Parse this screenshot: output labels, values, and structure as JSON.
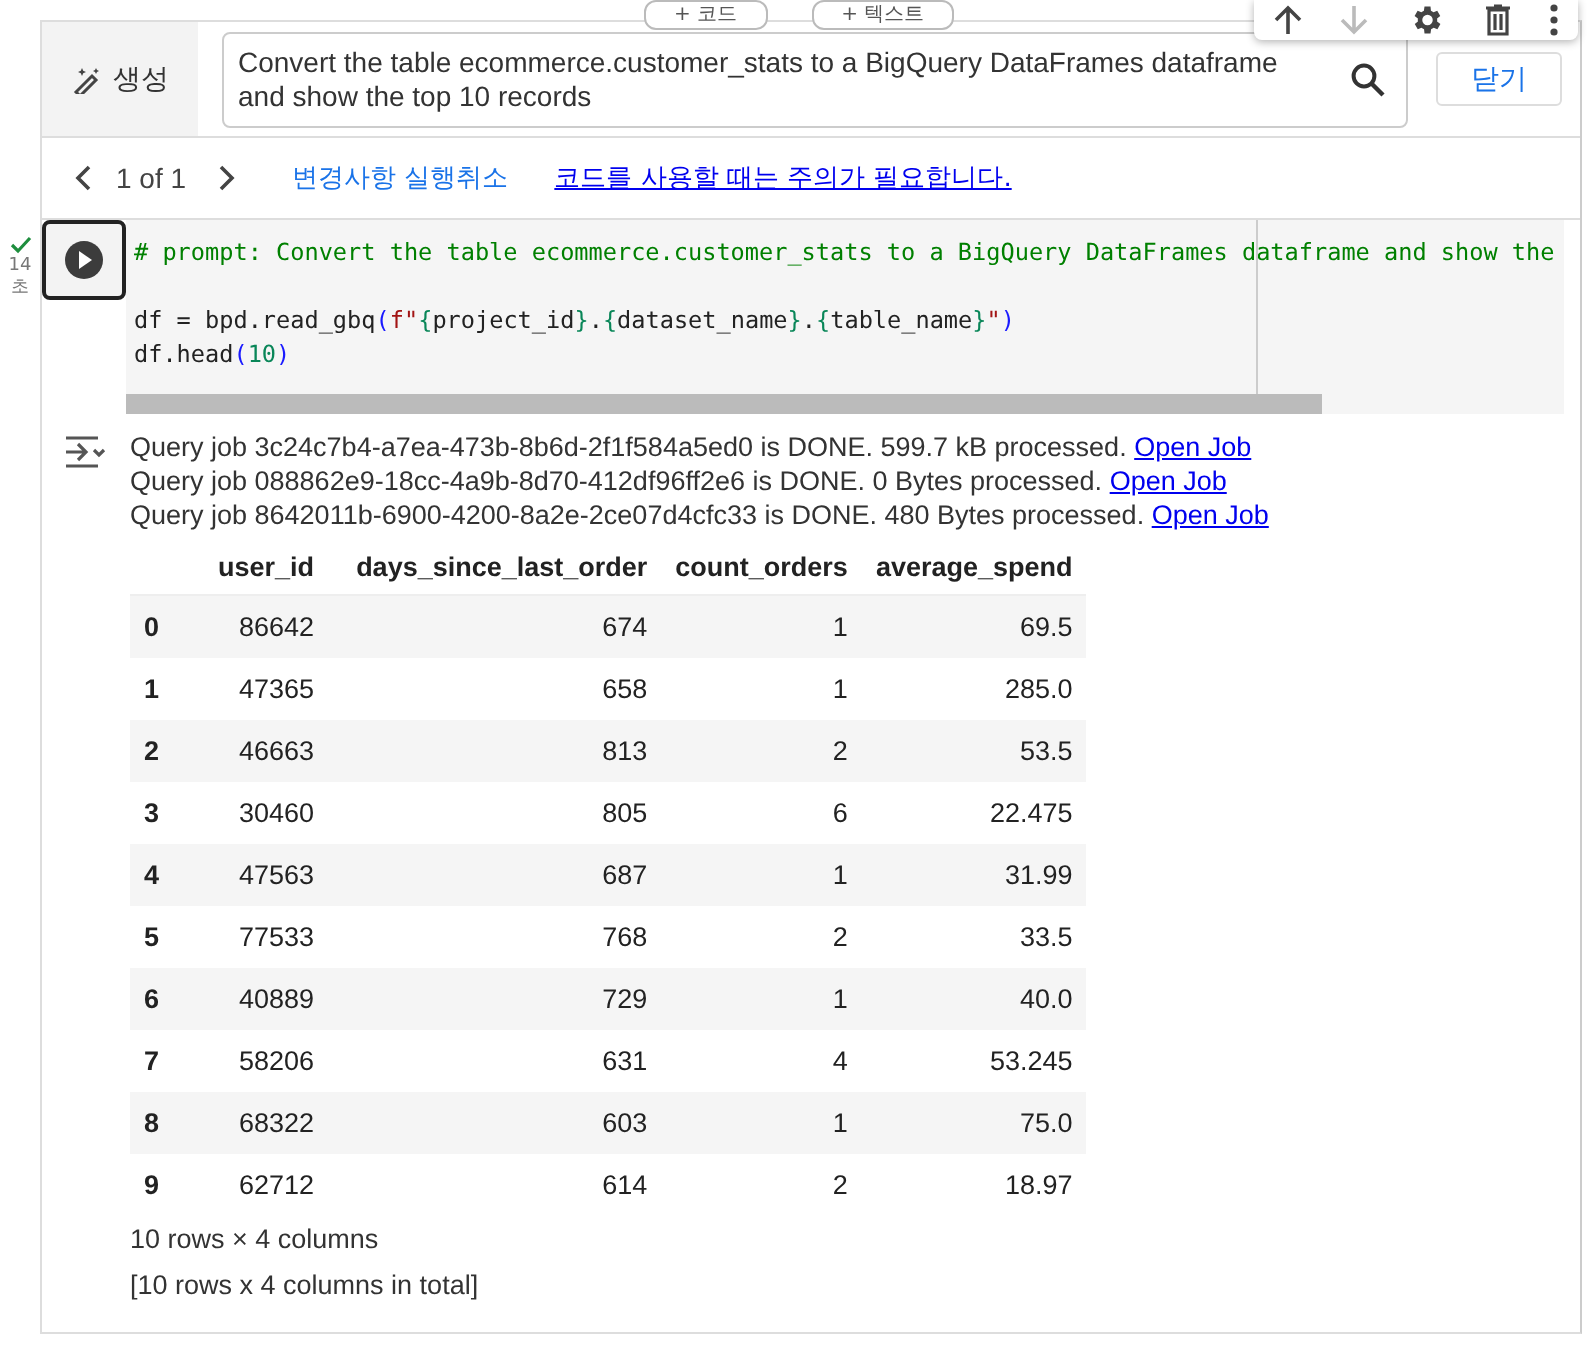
{
  "insert_buttons": [
    "+ 코드",
    "+ 텍스트"
  ],
  "cell_toolbar": [
    {
      "kind": "up",
      "disabled": false
    },
    {
      "kind": "down",
      "disabled": true
    },
    {
      "kind": "settings",
      "disabled": false
    },
    {
      "kind": "delete",
      "disabled": false
    },
    {
      "kind": "more",
      "disabled": false
    }
  ],
  "run_status": {
    "done": true,
    "time": "14",
    "unit": "초"
  },
  "generate": {
    "label": "생성",
    "prompt": "Convert the table ecommerce.customer_stats to a BigQuery DataFrames dataframe and show the top 10 records",
    "close": "닫기"
  },
  "nav": {
    "page": "1 of 1",
    "undo": "변경사항 실행취소",
    "warning": "코드를 사용할 때는 주의가 필요합니다."
  },
  "code_lines": [
    {
      "kind": "code",
      "tokens": [
        {
          "kind": "comment",
          "text": "# prompt: Convert the table ecommerce.customer_stats to a BigQuery DataFrames dataframe and show the"
        }
      ]
    },
    {
      "kind": "blank"
    },
    {
      "kind": "code",
      "tokens": [
        {
          "kind": "plain",
          "text": "df = bpd.read_gbq"
        },
        {
          "kind": "paren",
          "text": "("
        },
        {
          "kind": "string",
          "text": "f\""
        },
        {
          "kind": "brace",
          "text": "{"
        },
        {
          "kind": "plain",
          "text": "project_id"
        },
        {
          "kind": "brace",
          "text": "}"
        },
        {
          "kind": "plain",
          "text": "."
        },
        {
          "kind": "brace",
          "text": "{"
        },
        {
          "kind": "plain",
          "text": "dataset_name"
        },
        {
          "kind": "brace",
          "text": "}"
        },
        {
          "kind": "plain",
          "text": "."
        },
        {
          "kind": "brace",
          "text": "{"
        },
        {
          "kind": "plain",
          "text": "table_name"
        },
        {
          "kind": "brace",
          "text": "}"
        },
        {
          "kind": "string",
          "text": "\""
        },
        {
          "kind": "paren",
          "text": ")"
        }
      ]
    },
    {
      "kind": "code",
      "tokens": [
        {
          "kind": "plain",
          "text": "df.head"
        },
        {
          "kind": "paren",
          "text": "("
        },
        {
          "kind": "number",
          "text": "10"
        },
        {
          "kind": "paren",
          "text": ")"
        }
      ]
    }
  ],
  "output_log": [
    {
      "text": "Query job 3c24c7b4-a7ea-473b-8b6d-2f1f584a5ed0 is DONE. 599.7 kB processed.",
      "link": "Open Job"
    },
    {
      "text": "Query job 088862e9-18cc-4a9b-8d70-412df96ff2e6 is DONE. 0 Bytes processed.",
      "link": "Open Job"
    },
    {
      "text": "Query job 8642011b-6900-4200-8a2e-2ce07d4cfc33 is DONE. 480 Bytes processed.",
      "link": "Open Job"
    }
  ],
  "table": {
    "columns": [
      "",
      "user_id",
      "days_since_last_order",
      "count_orders",
      "average_spend"
    ],
    "rows": [
      [
        "0",
        "86642",
        "674",
        "1",
        "69.5"
      ],
      [
        "1",
        "47365",
        "658",
        "1",
        "285.0"
      ],
      [
        "2",
        "46663",
        "813",
        "2",
        "53.5"
      ],
      [
        "3",
        "30460",
        "805",
        "6",
        "22.475"
      ],
      [
        "4",
        "47563",
        "687",
        "1",
        "31.99"
      ],
      [
        "5",
        "77533",
        "768",
        "2",
        "33.5"
      ],
      [
        "6",
        "40889",
        "729",
        "1",
        "40.0"
      ],
      [
        "7",
        "58206",
        "631",
        "4",
        "53.245"
      ],
      [
        "8",
        "68322",
        "603",
        "1",
        "75.0"
      ],
      [
        "9",
        "62712",
        "614",
        "2",
        "18.97"
      ]
    ]
  },
  "footer": [
    "10 rows × 4 columns",
    "[10 rows x 4 columns in total]"
  ]
}
